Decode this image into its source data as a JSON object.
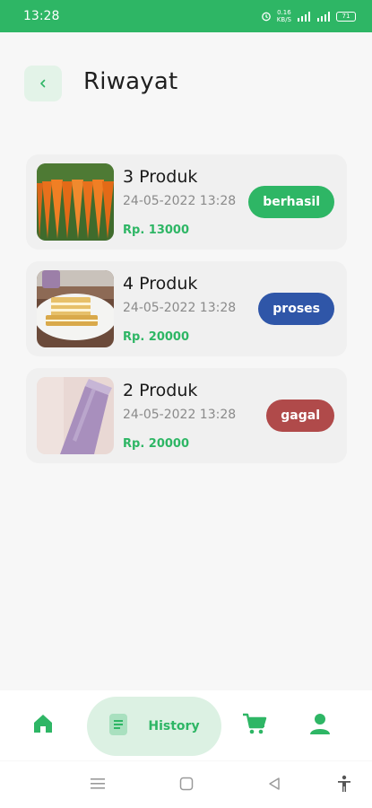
{
  "status_bar": {
    "time": "13:28",
    "speed_value": "0.16",
    "speed_unit": "KB/S",
    "battery": "71",
    "icons": [
      "alarm-icon",
      "network-speed-icon",
      "signal-icon",
      "signal-icon",
      "battery-icon"
    ]
  },
  "header": {
    "title": "Riwayat",
    "back_icon": "chevron-left-icon"
  },
  "orders": [
    {
      "count": "3 Produk",
      "date": "24-05-2022 13:28",
      "price": "Rp. 13000",
      "status": "berhasil",
      "status_color": "#2eb665",
      "thumbnail": "carrots-photo"
    },
    {
      "count": "4 Produk",
      "date": "24-05-2022 13:28",
      "price": "Rp. 20000",
      "status": "proses",
      "status_color": "#2f56a8",
      "thumbnail": "wafer-snack-photo"
    },
    {
      "count": "2 Produk",
      "date": "24-05-2022 13:28",
      "price": "Rp. 20000",
      "status": "gagal",
      "status_color": "#b04a4a",
      "thumbnail": "lotion-bottle-photo"
    }
  ],
  "bottom_nav": {
    "home_icon": "home-icon",
    "history_label": "History",
    "history_icon": "document-icon",
    "cart_icon": "cart-icon",
    "profile_icon": "user-icon",
    "accent_color": "#2eb665"
  },
  "system_nav": {
    "icons": [
      "menu-icon",
      "square-home-icon",
      "triangle-back-icon",
      "accessibility-icon"
    ]
  }
}
